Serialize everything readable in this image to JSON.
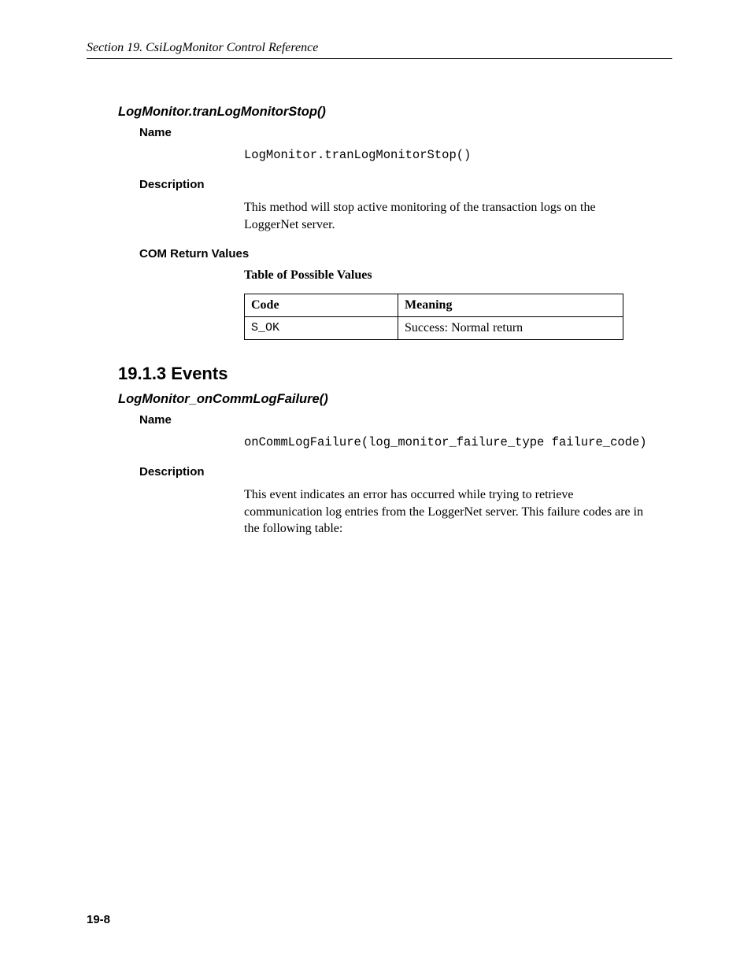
{
  "header": {
    "running_head": "Section 19.  CsiLogMonitor Control Reference"
  },
  "method1": {
    "title": "LogMonitor.tranLogMonitorStop()",
    "name_label": "Name",
    "name_value": "LogMonitor.tranLogMonitorStop()",
    "desc_label": "Description",
    "desc_text": "This method will stop active monitoring of the transaction logs on the LoggerNet server.",
    "com_label": "COM Return Values",
    "table_caption": "Table of Possible Values",
    "table": {
      "th_code": "Code",
      "th_meaning": "Meaning",
      "r0_code": "S_OK",
      "r0_meaning": "Success: Normal return"
    }
  },
  "section": {
    "heading": "19.1.3  Events"
  },
  "event1": {
    "title": "LogMonitor_onCommLogFailure()",
    "name_label": "Name",
    "name_value": "onCommLogFailure(log_monitor_failure_type failure_code)",
    "desc_label": "Description",
    "desc_text": "This event indicates an error has occurred while trying to retrieve communication log entries from the LoggerNet server.   This failure codes are in the following table:"
  },
  "footer": {
    "page_number": "19-8"
  }
}
